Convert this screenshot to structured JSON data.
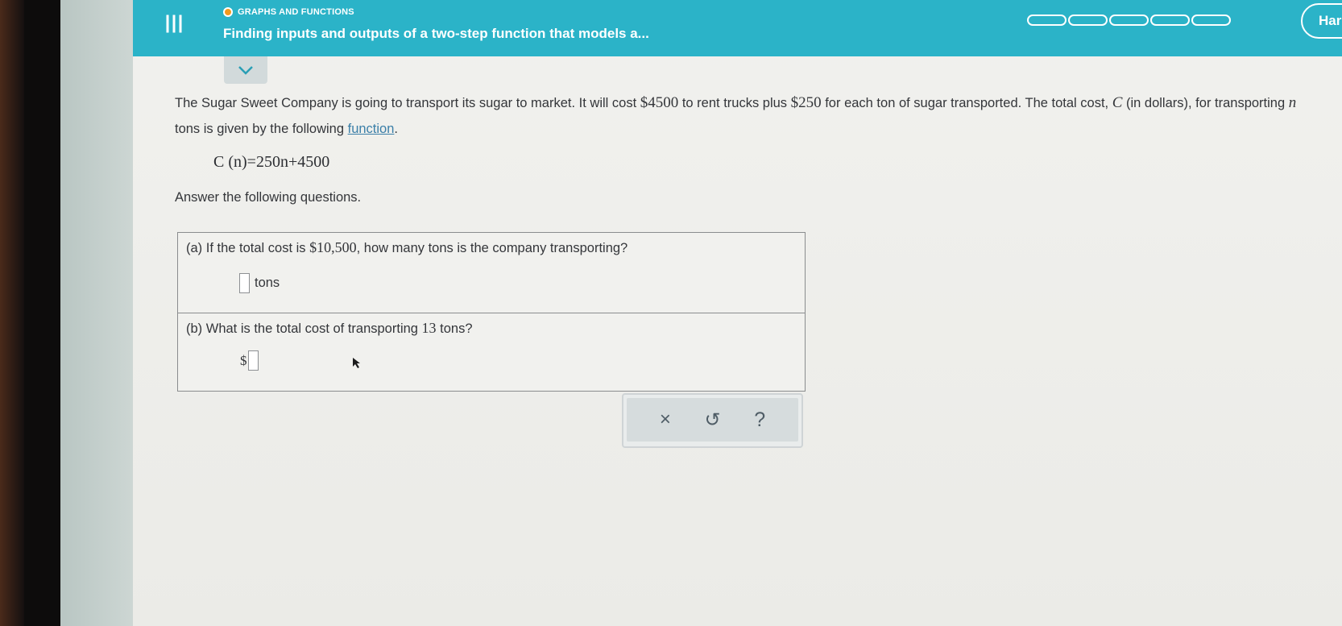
{
  "header": {
    "topic": "GRAPHS AND FUNCTIONS",
    "lesson_title": "Finding inputs and outputs of a two-step function that models a...",
    "profile_label": "Har"
  },
  "problem": {
    "text_1": "The Sugar Sweet Company is going to transport its sugar to market. It will cost ",
    "cost_fixed": "$4500",
    "text_2": " to rent trucks plus ",
    "cost_per_ton": "$250",
    "text_3": " for each ton of sugar transported. The total cost, ",
    "var_c": "C",
    "text_4": " (in dollars), for transporting ",
    "var_n": "n",
    "text_5": " tons is given by the following ",
    "link_text": "function",
    "text_6": ".",
    "formula": "C (n)=250n+4500",
    "answer_intro": "Answer the following questions."
  },
  "questions": {
    "a_prefix": "(a)  If the total cost is ",
    "a_value": "$10,500",
    "a_suffix": ", how many tons is the company transporting?",
    "a_unit": "tons",
    "b_prefix": "(b)  What is the total cost of transporting ",
    "b_value": "13",
    "b_suffix": " tons?",
    "b_currency": "$"
  },
  "toolbar": {
    "clear": "×",
    "undo": "↺",
    "help": "?"
  },
  "colors": {
    "accent": "#2bb3c8",
    "topic_dot": "#f39a1e"
  }
}
